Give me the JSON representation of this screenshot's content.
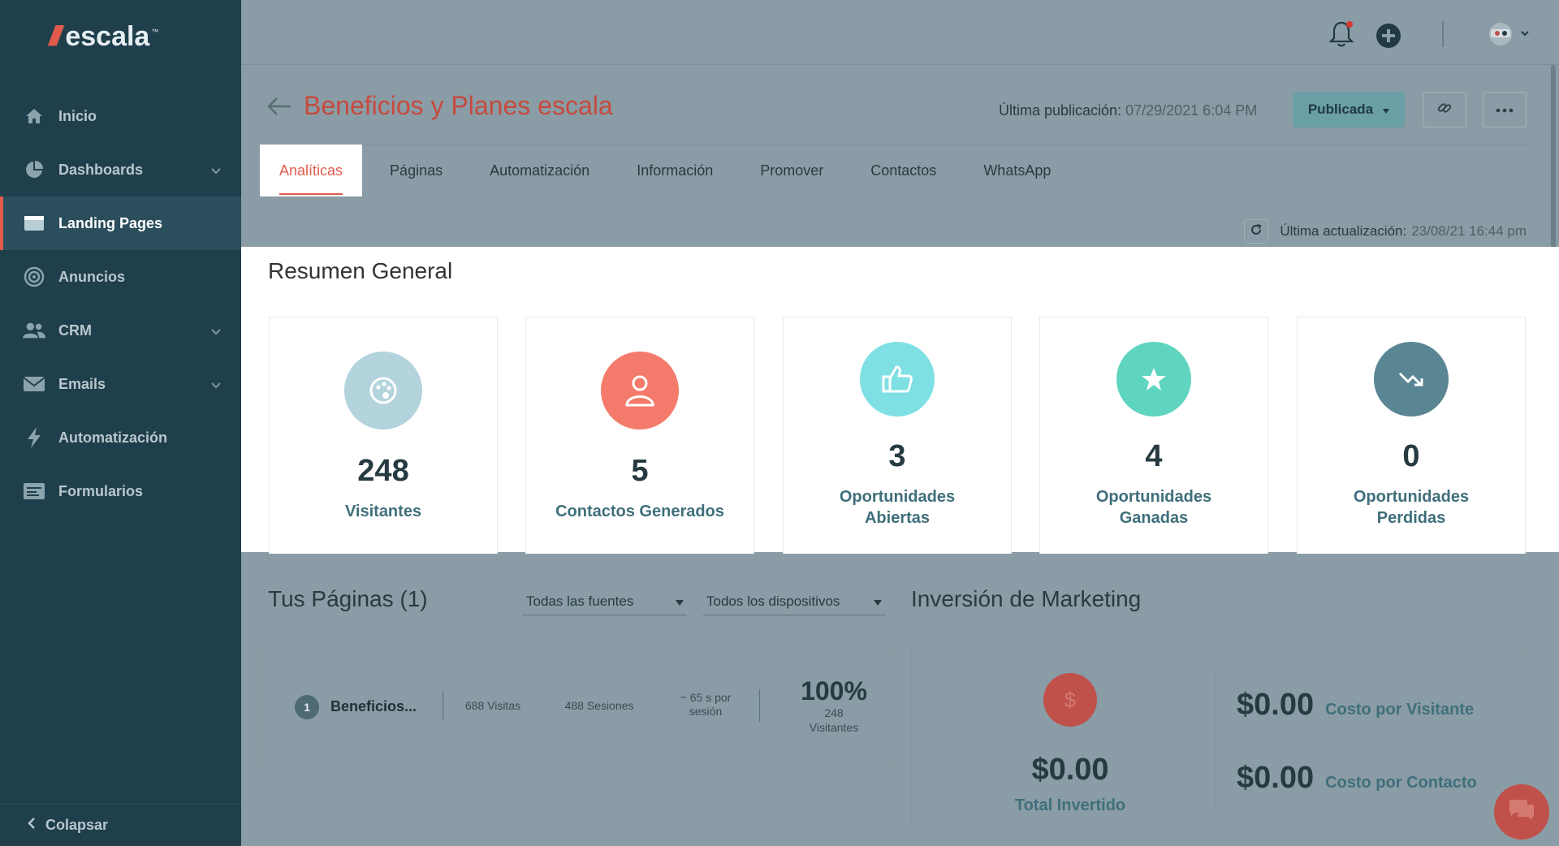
{
  "brand": {
    "logo_text": "escala",
    "tm": "™"
  },
  "sidebar": {
    "items": [
      {
        "label": "Inicio",
        "icon": "home-icon",
        "has_chevron": false,
        "active": false
      },
      {
        "label": "Dashboards",
        "icon": "pie-chart-icon",
        "has_chevron": true,
        "active": false
      },
      {
        "label": "Landing Pages",
        "icon": "browser-window-icon",
        "has_chevron": false,
        "active": true
      },
      {
        "label": "Anuncios",
        "icon": "target-icon",
        "has_chevron": false,
        "active": false
      },
      {
        "label": "CRM",
        "icon": "users-icon",
        "has_chevron": true,
        "active": false
      },
      {
        "label": "Emails",
        "icon": "envelope-icon",
        "has_chevron": true,
        "active": false
      },
      {
        "label": "Automatización",
        "icon": "lightning-icon",
        "has_chevron": false,
        "active": false
      },
      {
        "label": "Formularios",
        "icon": "form-icon",
        "has_chevron": false,
        "active": false
      }
    ],
    "collapse_label": "Colapsar"
  },
  "topbar": {
    "icons": [
      "bell-icon",
      "plus-circle-icon",
      "avatar-icon"
    ]
  },
  "header": {
    "title": "Beneficios y Planes escala",
    "last_pub_label": "Última publicación:",
    "last_pub_value": "07/29/2021 6:04 PM",
    "status_button": "Publicada"
  },
  "tabs": [
    "Analíticas",
    "Páginas",
    "Automatización",
    "Información",
    "Promover",
    "Contactos",
    "WhatsApp"
  ],
  "last_update": {
    "label": "Última actualización:",
    "value": "23/08/21 16:44 pm"
  },
  "resumen": {
    "title": "Resumen General",
    "cards": [
      {
        "value": "248",
        "label_line1": "Visitantes",
        "label_line2": "",
        "color": "#b3d3dd",
        "icon": "palette-icon"
      },
      {
        "value": "5",
        "label_line1": "Contactos Generados",
        "label_line2": "",
        "color": "#f47b6b",
        "icon": "person-icon"
      },
      {
        "value": "3",
        "label_line1": "Oportunidades",
        "label_line2": "Abiertas",
        "color": "#7fe0e4",
        "icon": "thumbs-up-icon"
      },
      {
        "value": "4",
        "label_line1": "Oportunidades",
        "label_line2": "Ganadas",
        "color": "#5fd5c0",
        "icon": "star-icon"
      },
      {
        "value": "0",
        "label_line1": "Oportunidades",
        "label_line2": "Perdidas",
        "color": "#5a8593",
        "icon": "trend-down-icon"
      }
    ]
  },
  "pages_section": {
    "title": "Tus Páginas (1)",
    "filter_sources": "Todas las fuentes",
    "filter_devices": "Todos los dispositivos",
    "row": {
      "index": "1",
      "name": "Beneficios...",
      "visits": "688 Visitas",
      "sessions": "488 Sesiones",
      "avg_line1": "~ 65 s por",
      "avg_line2": "sesión",
      "pct": "100%",
      "pct_sub1": "248",
      "pct_sub2": "Visitantes"
    }
  },
  "investment": {
    "title": "Inversión de Marketing",
    "currency_symbol": "$",
    "total": "$0.00",
    "total_label": "Total Invertido",
    "cost_visitor": "$0.00",
    "cost_visitor_label": "Costo por Visitante",
    "cost_contact": "$0.00",
    "cost_contact_label": "Costo por Contacto"
  }
}
